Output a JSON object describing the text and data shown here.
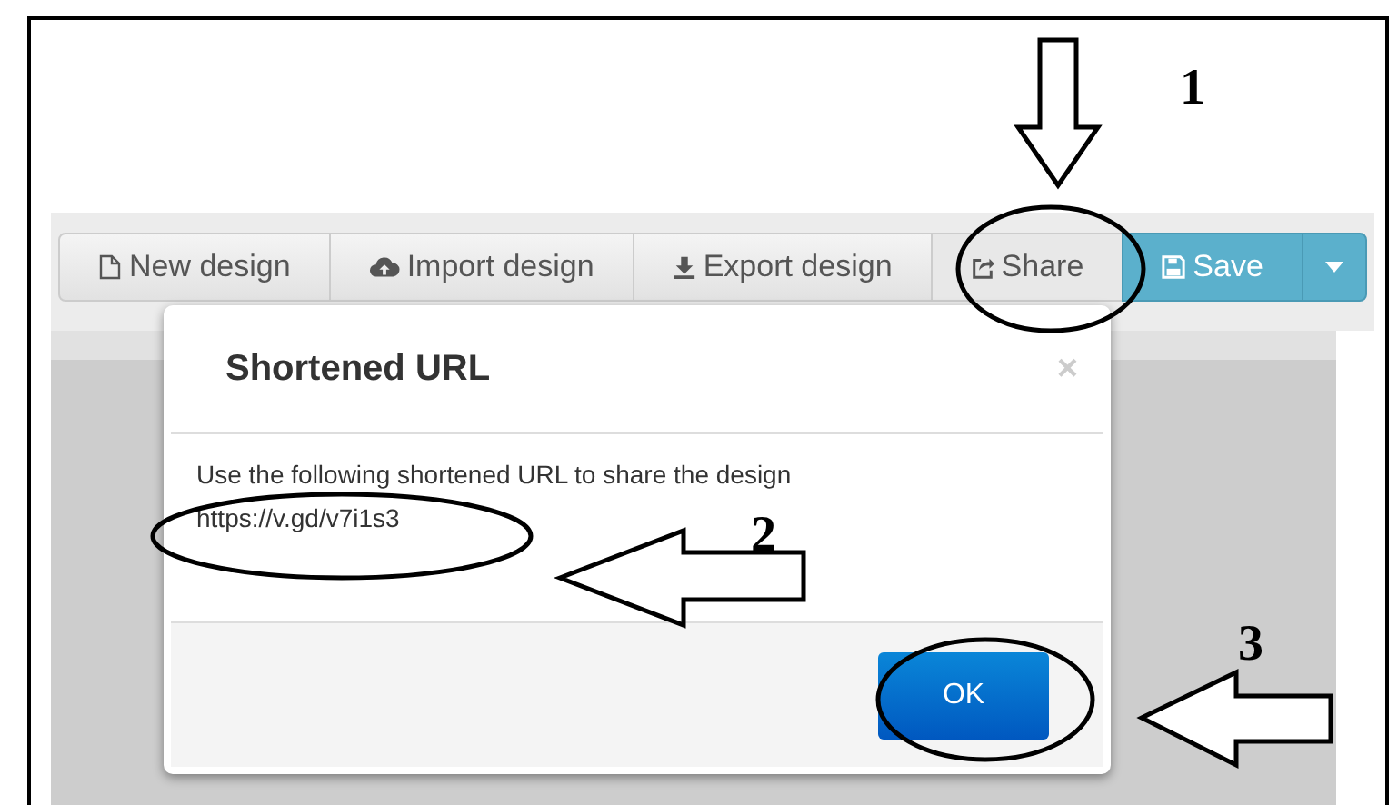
{
  "toolbar": [
    {
      "label": "New design",
      "kind": "new"
    },
    {
      "label": "Import design",
      "kind": "import"
    },
    {
      "label": "Export design",
      "kind": "export"
    },
    {
      "label": "Share",
      "kind": "share"
    },
    {
      "label": "Save",
      "kind": "save"
    },
    {
      "kind": "dropdown"
    }
  ],
  "dialog": {
    "title": "Shortened URL",
    "close": "×",
    "message": "Use the following shortened URL to share the design",
    "url": "https://v.gd/v7i1s3",
    "button": "OK"
  },
  "annotations": [
    {
      "number": "1"
    },
    {
      "number": "2"
    },
    {
      "number": "3"
    }
  ]
}
